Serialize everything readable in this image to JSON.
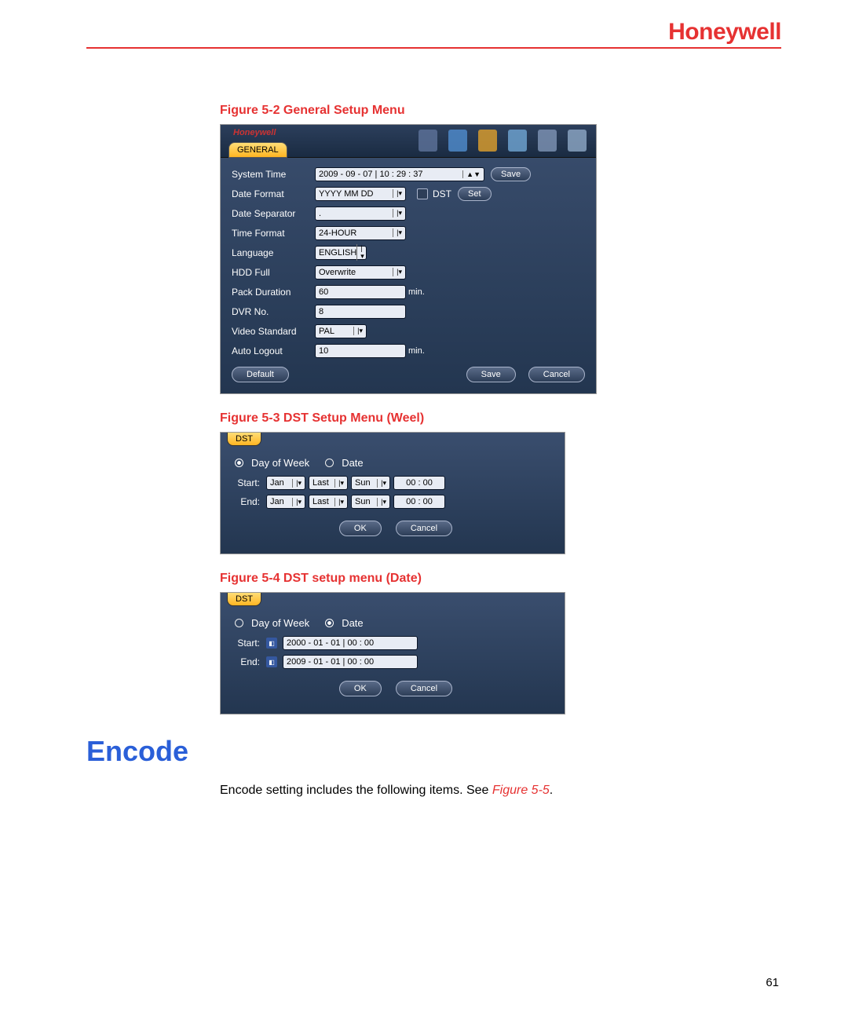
{
  "brand": "Honeywell",
  "captions": {
    "fig52": "Figure 5-2 General Setup Menu",
    "fig53": "Figure 5-3 DST Setup Menu (Weel)",
    "fig54": "Figure 5-4 DST setup menu (Date)"
  },
  "general": {
    "tab": "GENERAL",
    "brand_small": "Honeywell",
    "rows": {
      "system_time_lbl": "System Time",
      "system_time_val": "2009 - 09 - 07 | 10 : 29 : 37",
      "save_btn": "Save",
      "date_format_lbl": "Date Format",
      "date_format_val": "YYYY MM DD",
      "dst_lbl": "DST",
      "set_btn": "Set",
      "date_sep_lbl": "Date Separator",
      "date_sep_val": ".",
      "time_format_lbl": "Time Format",
      "time_format_val": "24-HOUR",
      "language_lbl": "Language",
      "language_val": "ENGLISH",
      "hdd_full_lbl": "HDD Full",
      "hdd_full_val": "Overwrite",
      "pack_lbl": "Pack Duration",
      "pack_val": "60",
      "pack_suffix": "min.",
      "dvr_lbl": "DVR No.",
      "dvr_val": "8",
      "video_lbl": "Video Standard",
      "video_val": "PAL",
      "auto_lbl": "Auto Logout",
      "auto_val": "10",
      "auto_suffix": "min."
    },
    "buttons": {
      "default": "Default",
      "save": "Save",
      "cancel": "Cancel"
    }
  },
  "dst_week": {
    "tab": "DST",
    "opt_dow": "Day of Week",
    "opt_date": "Date",
    "start_lbl": "Start:",
    "end_lbl": "End:",
    "month": "Jan",
    "week": "Last",
    "day": "Sun",
    "time": "00  :  00",
    "ok": "OK",
    "cancel": "Cancel"
  },
  "dst_date": {
    "tab": "DST",
    "opt_dow": "Day of Week",
    "opt_date": "Date",
    "start_lbl": "Start:",
    "end_lbl": "End:",
    "start_val": "2000 - 01 - 01 | 00 : 00",
    "end_val": "2009 - 01 - 01 | 00 : 00",
    "ok": "OK",
    "cancel": "Cancel"
  },
  "section_heading": "Encode",
  "body_text": "Encode setting includes the following items. See ",
  "body_ref": "Figure 5-5",
  "body_end": ".",
  "page_number": "61"
}
